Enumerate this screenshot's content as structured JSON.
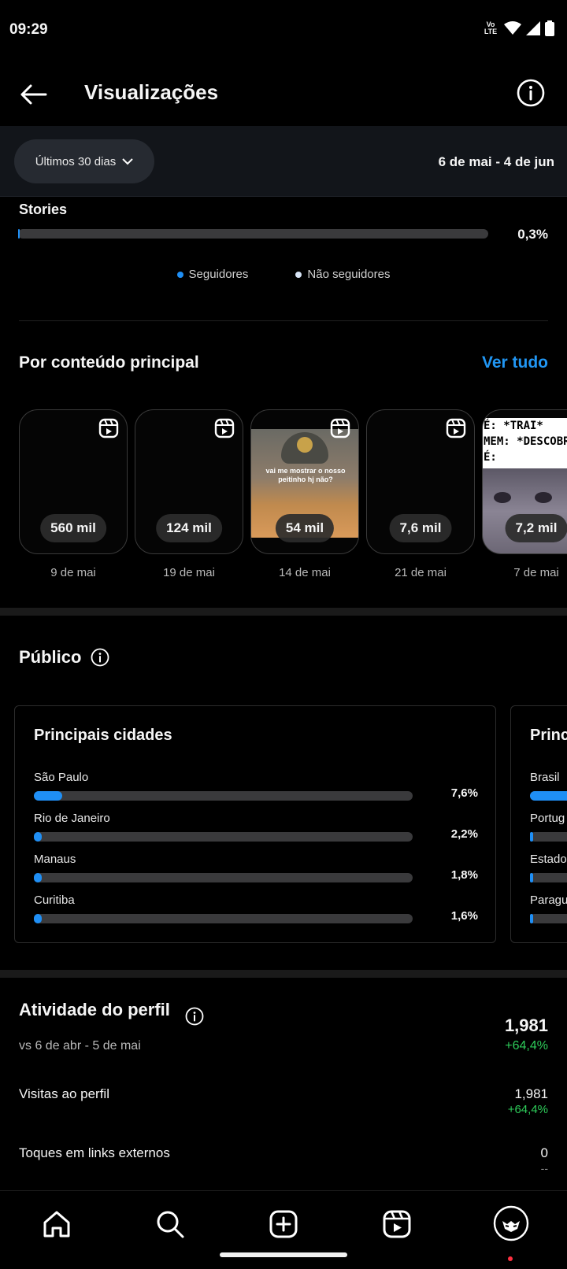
{
  "status_bar": {
    "time": "09:29",
    "network_label_top": "Vo",
    "network_label_bottom": "LTE"
  },
  "header": {
    "title": "Visualizações",
    "back_icon": "arrow-left-icon",
    "info_icon": "info-icon"
  },
  "filter": {
    "range_label": "Últimos 30 dias",
    "date_range": "6 de mai - 4 de jun"
  },
  "stories": {
    "label": "Stories",
    "percent_text": "0,3%",
    "fill_fraction": 0.003
  },
  "legend": {
    "followers": "Seguidores",
    "non_followers": "Não seguidores",
    "followers_color": "#1f8ff5",
    "non_followers_color": "#d8e4f5"
  },
  "top_content": {
    "title": "Por conteúdo principal",
    "see_all": "Ver tudo",
    "items": [
      {
        "views": "560 mil",
        "date": "9 de mai"
      },
      {
        "views": "124 mil",
        "date": "19 de mai"
      },
      {
        "views": "54 mil",
        "date": "14 de mai",
        "caption": "vai me mostrar o nosso peitinho hj não?"
      },
      {
        "views": "7,6 mil",
        "date": "21 de mai"
      },
      {
        "views": "7,2 mil",
        "date": "7 de mai",
        "meme_lines": [
          "É: *TRAI*",
          "MEM: *DESCOBRE",
          "É:"
        ]
      }
    ]
  },
  "audience": {
    "title": "Público",
    "cities_card": {
      "title": "Principais cidades",
      "rows": [
        {
          "name": "São Paulo",
          "percent_text": "7,6%",
          "value": 0.076
        },
        {
          "name": "Rio de Janeiro",
          "percent_text": "2,2%",
          "value": 0.022
        },
        {
          "name": "Manaus",
          "percent_text": "1,8%",
          "value": 0.018
        },
        {
          "name": "Curitiba",
          "percent_text": "1,6%",
          "value": 0.016
        }
      ]
    },
    "countries_card": {
      "title": "Princ",
      "rows": [
        {
          "name": "Brasil",
          "value": 0.9
        },
        {
          "name": "Portug",
          "value": 0.02
        },
        {
          "name": "Estado",
          "value": 0.01
        },
        {
          "name": "Paragu",
          "value": 0.01
        }
      ]
    }
  },
  "profile_activity": {
    "title": "Atividade do perfil",
    "comparison": "vs 6 de abr - 5 de mai",
    "total": "1,981",
    "total_change": "+64,4%",
    "rows": [
      {
        "label": "Visitas ao perfil",
        "value": "1,981",
        "change": "+64,4%"
      },
      {
        "label": "Toques em links externos",
        "value": "0",
        "change": "--"
      }
    ]
  },
  "bottom_nav": [
    "home-icon",
    "search-icon",
    "create-icon",
    "reels-icon",
    "profile-avatar"
  ]
}
